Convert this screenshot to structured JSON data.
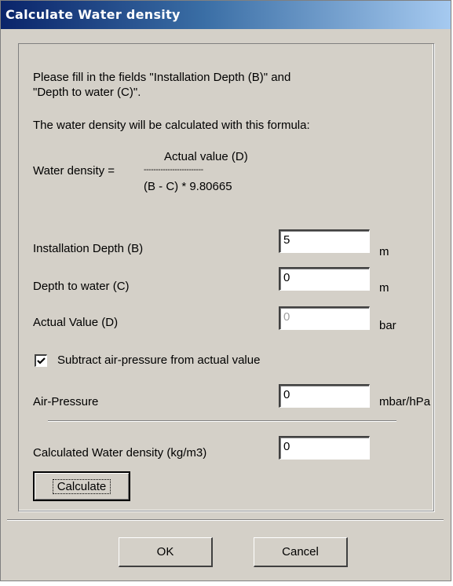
{
  "window": {
    "title": "Calculate Water density"
  },
  "instructions": {
    "line1": "Please fill in the fields \"Installation Depth (B)\" and",
    "line2": "\"Depth to water (C)\".",
    "formula_intro": "The water density will be calculated with this formula:"
  },
  "formula": {
    "lhs": "Water density =",
    "numerator": "Actual value (D)",
    "fraction_bar": "-------------------------",
    "denominator": "(B - C) * 9.80665"
  },
  "fields": {
    "installation_depth": {
      "label": "Installation Depth (B)",
      "value": "5",
      "unit": "m"
    },
    "depth_to_water": {
      "label": "Depth to water (C)",
      "value": "0",
      "unit": "m"
    },
    "actual_value": {
      "label": "Actual Value (D)",
      "value": "0",
      "unit": "bar",
      "disabled": true
    },
    "subtract_air_pressure": {
      "label": "Subtract air-pressure from actual value",
      "checked": true
    },
    "air_pressure": {
      "label": "Air-Pressure",
      "value": "0",
      "unit": "mbar/hPa"
    },
    "calculated_density": {
      "label": "Calculated Water density (kg/m3)",
      "value": "0"
    }
  },
  "buttons": {
    "calculate": "Calculate",
    "ok": "OK",
    "cancel": "Cancel"
  },
  "icons": {
    "checkmark": "checkmark-icon"
  }
}
